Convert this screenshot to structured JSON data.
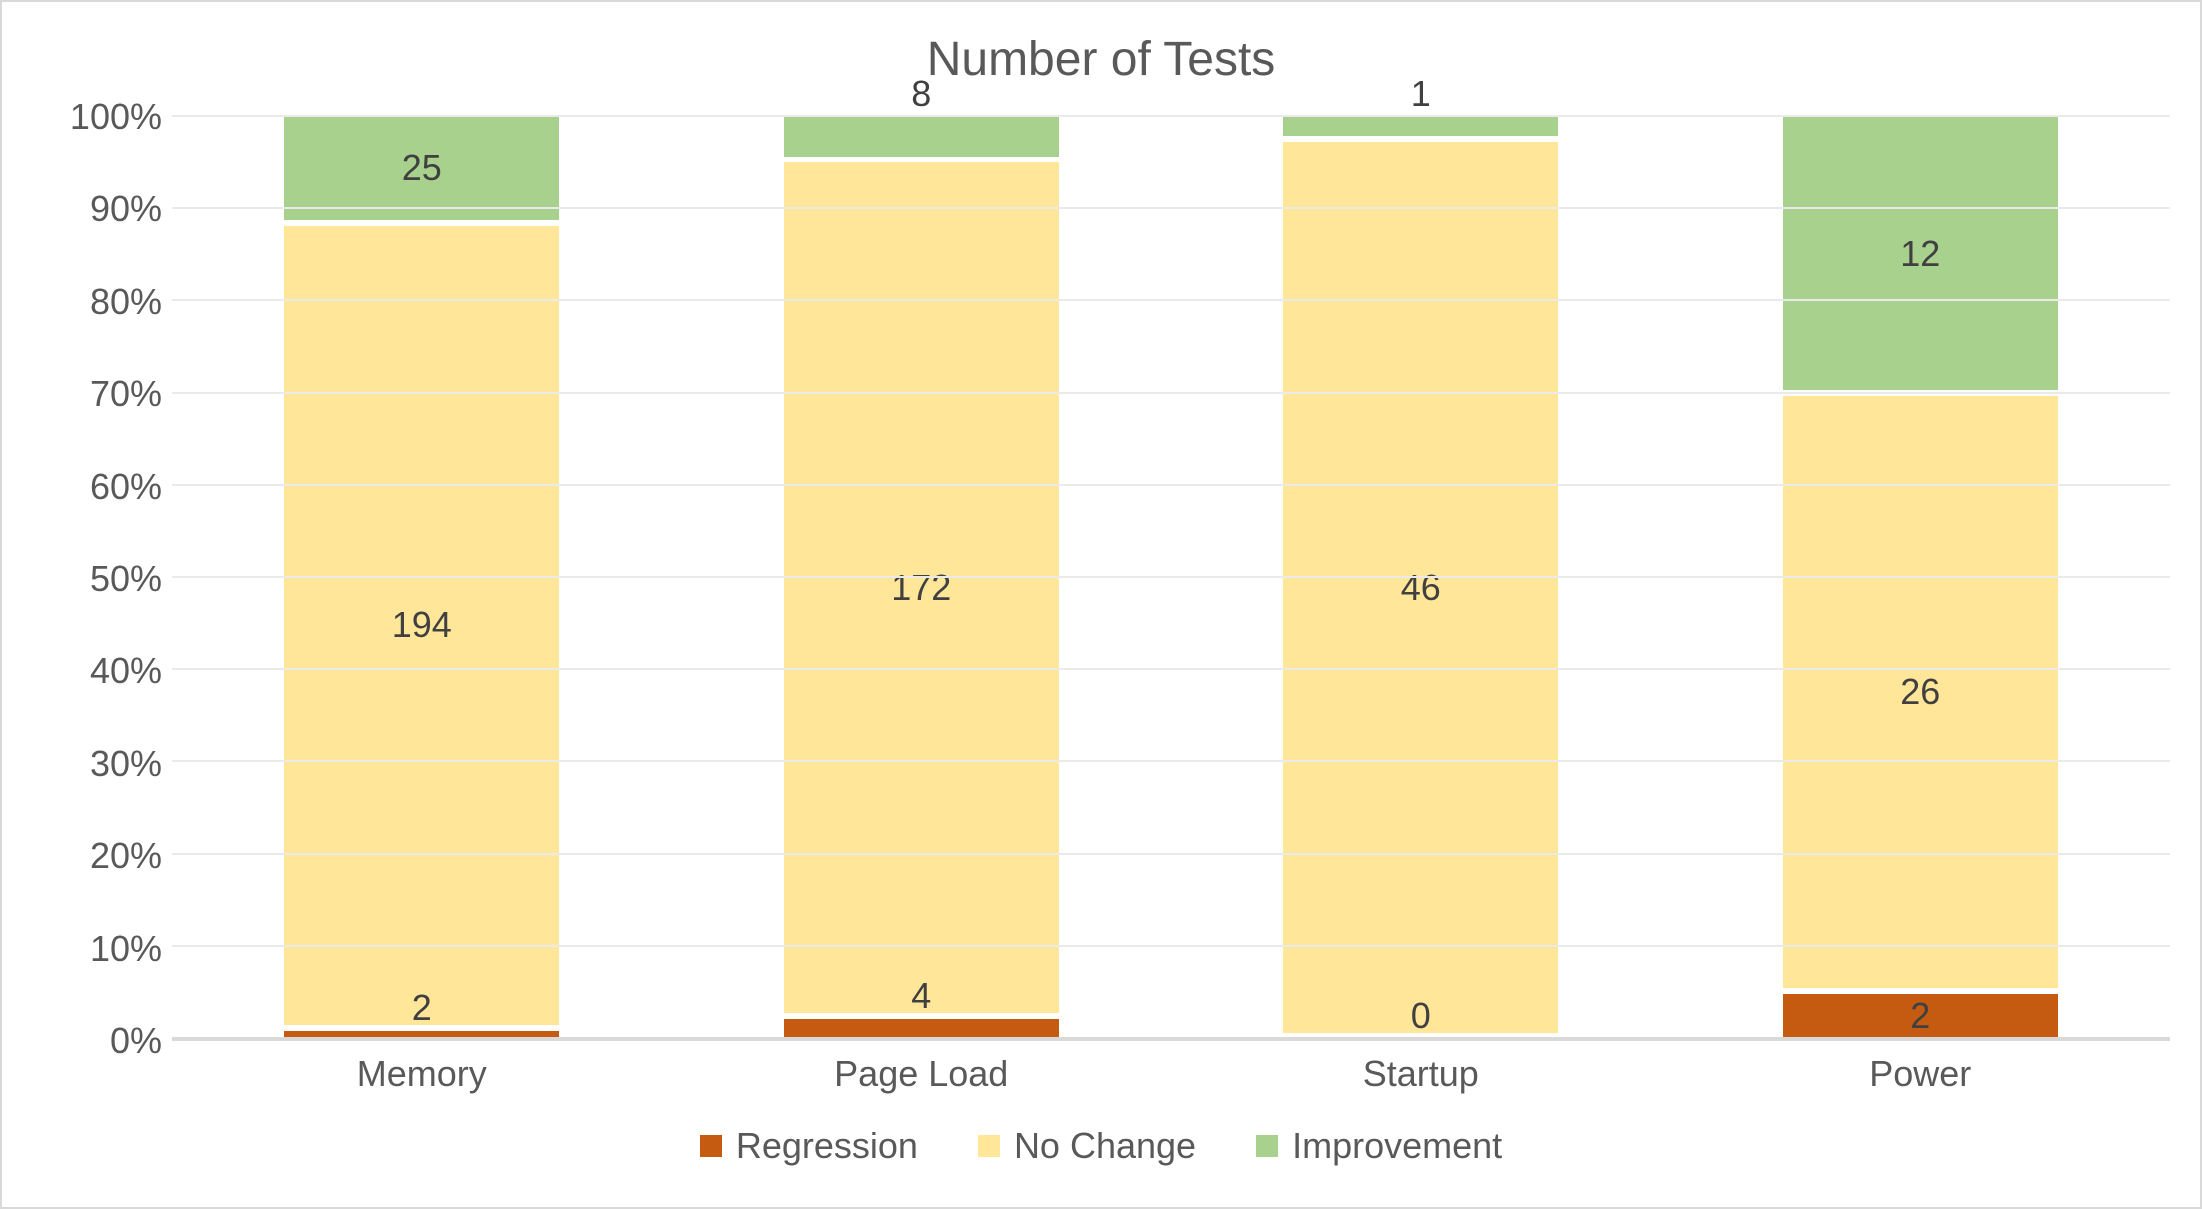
{
  "chart_data": {
    "type": "bar",
    "stacked": true,
    "percent": true,
    "title": "Number of Tests",
    "xlabel": "",
    "ylabel": "",
    "ylim": [
      0,
      100
    ],
    "yticks": [
      0,
      10,
      20,
      30,
      40,
      50,
      60,
      70,
      80,
      90,
      100
    ],
    "ytick_labels": [
      "0%",
      "10%",
      "20%",
      "30%",
      "40%",
      "50%",
      "60%",
      "70%",
      "80%",
      "90%",
      "100%"
    ],
    "categories": [
      "Memory",
      "Page Load",
      "Startup",
      "Power"
    ],
    "series": [
      {
        "name": "Regression",
        "color": "#c55a11",
        "values": [
          2,
          4,
          0,
          2
        ]
      },
      {
        "name": "No Change",
        "color": "#ffe699",
        "values": [
          194,
          172,
          46,
          26
        ]
      },
      {
        "name": "Improvement",
        "color": "#a9d18e",
        "values": [
          25,
          8,
          1,
          12
        ]
      }
    ],
    "legend_position": "bottom",
    "grid": true
  }
}
